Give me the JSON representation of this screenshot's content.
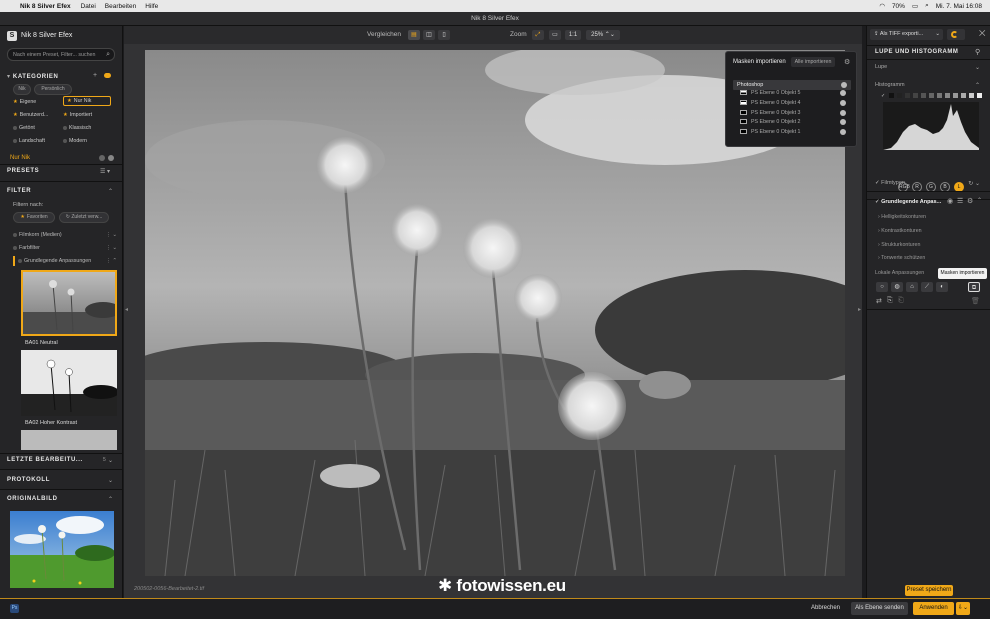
{
  "menubar": {
    "app_name": "Nik 8 Silver Efex",
    "items": [
      "Datei",
      "Bearbeiten",
      "Hilfe"
    ],
    "battery": "70%",
    "datetime": "Mi. 7. Mai 16:08"
  },
  "window": {
    "title": "Nik 8 Silver Efex"
  },
  "left": {
    "brand": "Nik 8 Silver Efex",
    "search_placeholder": "Nach einem Preset, Filter... suchen",
    "categories": {
      "header": "KATEGORIEN",
      "filter_pills": [
        "Nik",
        "Persönlich"
      ],
      "items_left": [
        "Eigene",
        "Benutzerd...",
        "Getönt",
        "Landschaft"
      ],
      "items_right": [
        "Nur Nik",
        "Importiert",
        "Klassisch",
        "Modern"
      ],
      "active_filter": "Nur Nik"
    },
    "presets_header": "PRESETS",
    "filter": {
      "header": "FILTER",
      "sub": "Filtern nach:",
      "pills": [
        "Favoriten",
        "Zuletzt verw..."
      ],
      "groups": [
        "Filmkorn (Medien)",
        "Farbfilter",
        "Grundlegende Anpassungen"
      ]
    },
    "thumbs": [
      "BA01 Neutral",
      "BA02 Hoher Kontrast"
    ],
    "recent_header": "LETZTE BEARBEITU...",
    "recent_count": "5",
    "protocol_header": "PROTOKOLL",
    "original_header": "ORIGINALBILD"
  },
  "center": {
    "compare_label": "Vergleichen",
    "zoom_label": "Zoom",
    "zoom_ratio": "1:1",
    "zoom_value": "25%",
    "filename": "200502-0056-Bearbeitet-2.tif",
    "watermark": "fotowissen.eu"
  },
  "mask_popup": {
    "title": "Masken importieren",
    "import_all": "Alle importieren",
    "source": "Photoshop",
    "layers": [
      "PS Ebene 0 Objekt 5",
      "PS Ebene 0 Objekt 4",
      "PS Ebene 0 Objekt 3",
      "PS Ebene 0 Objekt 2",
      "PS Ebene 0 Objekt 1"
    ]
  },
  "right": {
    "export_label": "Als TIFF exporti...",
    "panel_header": "LUPE UND HISTOGRAMM",
    "loupe": "Lupe",
    "histogram": "Histogramm",
    "channels": [
      "RGB",
      "R",
      "G",
      "B",
      "L"
    ],
    "film_types": "Filmtypen",
    "basic": "Grundlegende Anpas...",
    "adjustments": [
      "Helligkeitskonturen",
      "Kontrastkonturen",
      "Strukturkonturen",
      "Tonwerte schützen"
    ],
    "local": "Lokale Anpassungen",
    "tooltip": "Masken importieren",
    "save_preset": "Preset speichern"
  },
  "bottom": {
    "cancel": "Abbrechen",
    "as_layer": "Als Ebene senden",
    "apply": "Anwenden"
  },
  "colors": {
    "accent": "#f0a818",
    "panel": "#252527",
    "canvas": "#333335"
  }
}
